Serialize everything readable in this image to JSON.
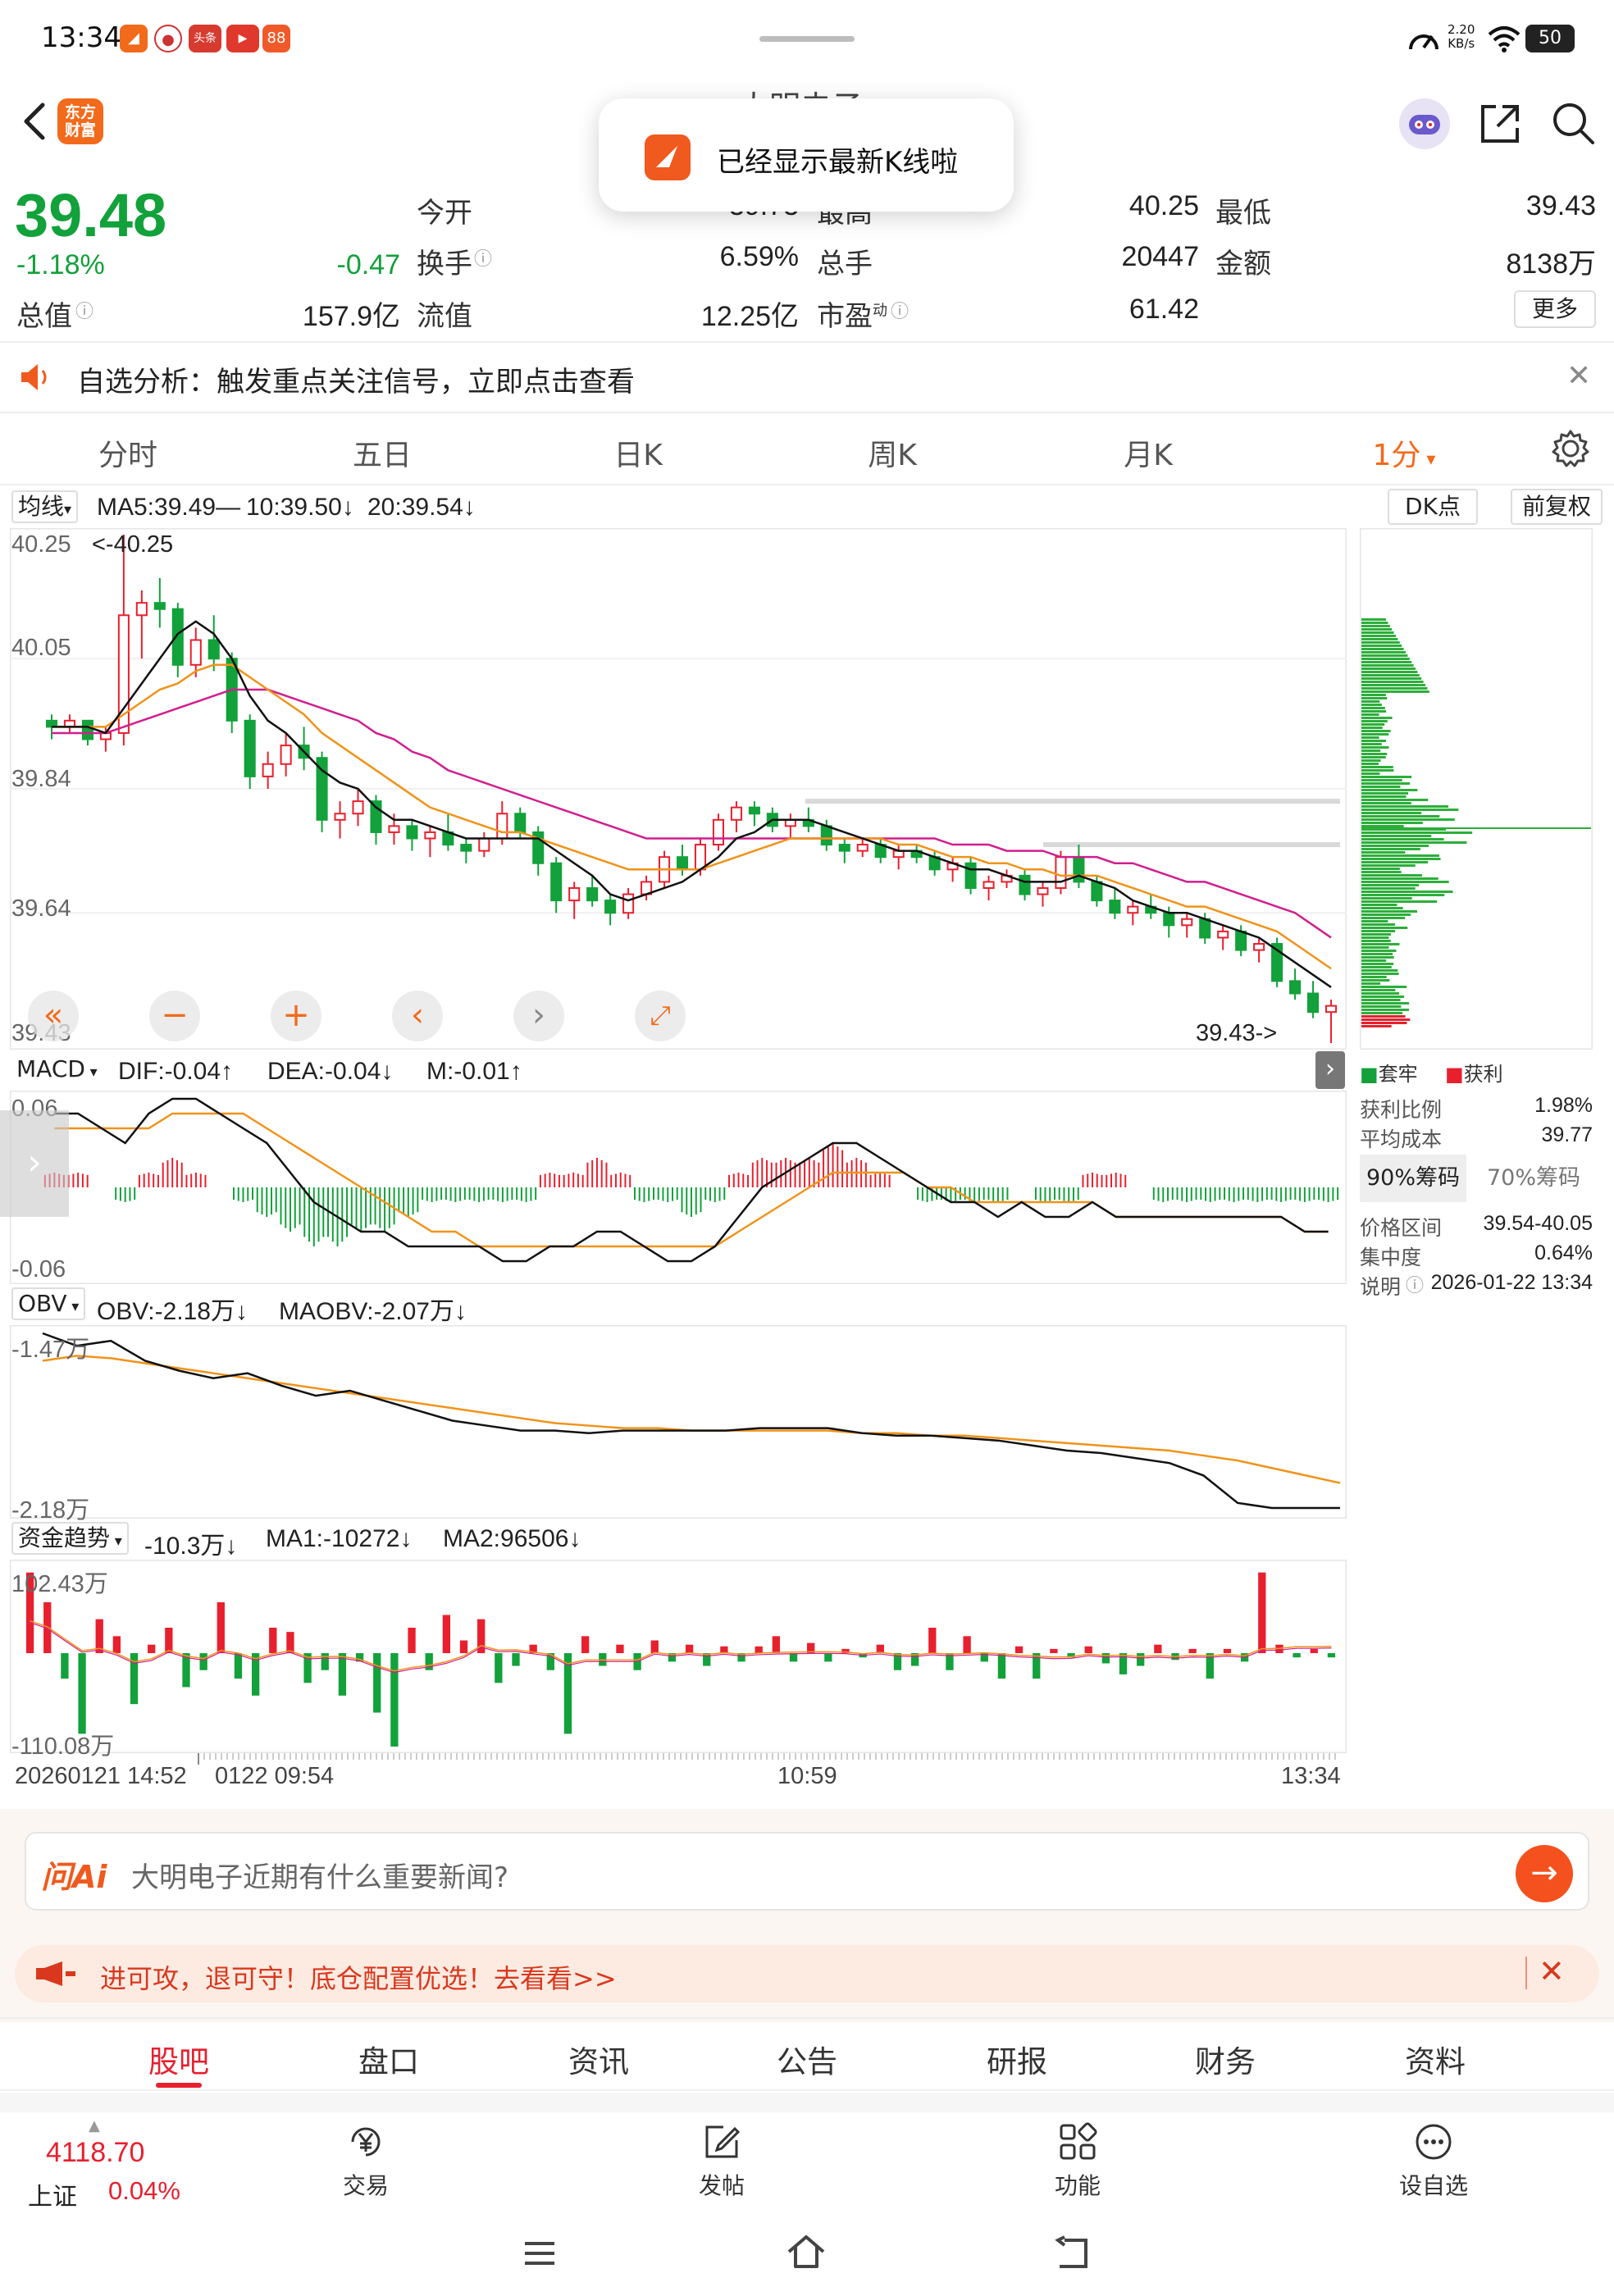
{
  "status_bar": {
    "time": "13:34",
    "net_speed_value": "2.20",
    "net_speed_unit": "KB/s",
    "battery": "50"
  },
  "toolbar": {
    "title": "大明电子",
    "logo_line1": "东方",
    "logo_line2": "财富"
  },
  "toast": {
    "text": "已经显示最新K线啦"
  },
  "quote": {
    "price": "39.48",
    "change_pct": "-1.18%",
    "change": "-0.47",
    "total_value_label": "总值",
    "total_value": "157.9亿",
    "open_label": "今开",
    "open": "39.73",
    "high_label": "最高",
    "high": "40.25",
    "low_label": "最低",
    "low": "39.43",
    "turnover_label": "换手",
    "turnover": "6.59%",
    "volume_label": "总手",
    "volume": "20447",
    "amount_label": "金额",
    "amount": "8138万",
    "float_label": "流值",
    "float_value": "12.25亿",
    "pe_label": "市盈",
    "pe_sup": "动",
    "pe": "61.42",
    "more_label": "更多"
  },
  "alert": {
    "text": "自选分析：触发重点关注信号，立即点击查看"
  },
  "period_tabs": [
    "分时",
    "五日",
    "日K",
    "周K",
    "月K",
    "1分"
  ],
  "kline": {
    "selector": "均线",
    "ma5": "MA5:39.49—",
    "ma10": "10:39.50",
    "ma20": "20:39.54",
    "dk_label": "DK点",
    "fuquan_label": "前复权",
    "y_ticks": [
      "40.25",
      "40.05",
      "39.84",
      "39.64",
      "39.43"
    ],
    "high_marker": "<-40.25",
    "low_marker": "39.43->"
  },
  "macd": {
    "selector": "MACD",
    "dif": "DIF:-0.04",
    "dea": "DEA:-0.04",
    "m": "M:-0.01",
    "y_top": "0.06",
    "y_bottom": "-0.06"
  },
  "obv": {
    "selector": "OBV",
    "obv": "OBV:-2.18万",
    "maobv": "MAOBV:-2.07万",
    "y_top": "-1.47万",
    "y_bottom": "-2.18万"
  },
  "fund": {
    "selector": "资金趋势",
    "value": "-10.3万",
    "ma1": "MA1:-10272",
    "ma2": "MA2:96506",
    "y_top": "102.43万",
    "y_bottom": "-110.08万"
  },
  "time_axis": [
    "20260121 14:52",
    "0122 09:54",
    "10:59",
    "13:34"
  ],
  "chips": {
    "legend_trapped": "套牢",
    "legend_profit": "获利",
    "profit_ratio_label": "获利比例",
    "profit_ratio": "1.98%",
    "avg_cost_label": "平均成本",
    "avg_cost": "39.77",
    "tab_90": "90%筹码",
    "tab_70": "70%筹码",
    "price_range_label": "价格区间",
    "price_range": "39.54-40.05",
    "concentration_label": "集中度",
    "concentration": "0.64%",
    "note_label": "说明",
    "note_date": "2026-01-22 13:34"
  },
  "ai": {
    "logo": "问Ai",
    "prompt": "大明电子近期有什么重要新闻?"
  },
  "promo": {
    "text": "进可攻，退可守！底仓配置优选！去看看>>"
  },
  "content_tabs": [
    "股吧",
    "盘口",
    "资讯",
    "公告",
    "研报",
    "财务",
    "资料"
  ],
  "bottom_nav": {
    "index_value": "4118.70",
    "index_name": "上证",
    "index_change": "0.04%",
    "items": [
      "交易",
      "发帖",
      "功能",
      "设自选"
    ]
  },
  "colors": {
    "up": "#e8202e",
    "down": "#12a13a",
    "ma5": "#111111",
    "ma10": "#f09319",
    "ma20": "#d01f8e",
    "accent": "#f26a1b"
  },
  "chart_data": [
    {
      "type": "candlestick",
      "title": "1分 K线",
      "ylim": [
        39.43,
        40.25
      ],
      "series_names": [
        "MA5",
        "MA10",
        "MA20"
      ],
      "candles": [
        [
          39.95,
          39.96,
          39.92,
          39.94
        ],
        [
          39.94,
          39.96,
          39.93,
          39.95
        ],
        [
          39.95,
          39.95,
          39.91,
          39.92
        ],
        [
          39.92,
          39.94,
          39.9,
          39.93
        ],
        [
          39.93,
          40.25,
          39.91,
          40.12
        ],
        [
          40.12,
          40.16,
          40.05,
          40.14
        ],
        [
          40.14,
          40.18,
          40.1,
          40.13
        ],
        [
          40.13,
          40.14,
          40.02,
          40.04
        ],
        [
          40.04,
          40.1,
          40.02,
          40.08
        ],
        [
          40.08,
          40.12,
          40.03,
          40.05
        ],
        [
          40.05,
          40.06,
          39.93,
          39.95
        ],
        [
          39.95,
          39.96,
          39.84,
          39.86
        ],
        [
          39.86,
          39.9,
          39.84,
          39.88
        ],
        [
          39.88,
          39.93,
          39.86,
          39.91
        ],
        [
          39.91,
          39.94,
          39.87,
          39.89
        ],
        [
          39.89,
          39.9,
          39.77,
          39.79
        ],
        [
          39.79,
          39.82,
          39.76,
          39.8
        ],
        [
          39.8,
          39.84,
          39.78,
          39.82
        ],
        [
          39.82,
          39.83,
          39.75,
          39.77
        ],
        [
          39.77,
          39.8,
          39.75,
          39.78
        ],
        [
          39.78,
          39.79,
          39.74,
          39.76
        ],
        [
          39.76,
          39.78,
          39.73,
          39.77
        ],
        [
          39.77,
          39.8,
          39.74,
          39.75
        ],
        [
          39.75,
          39.76,
          39.72,
          39.74
        ],
        [
          39.74,
          39.77,
          39.73,
          39.76
        ],
        [
          39.76,
          39.82,
          39.75,
          39.8
        ],
        [
          39.8,
          39.81,
          39.76,
          39.77
        ],
        [
          39.77,
          39.78,
          39.7,
          39.72
        ],
        [
          39.72,
          39.73,
          39.64,
          39.66
        ],
        [
          39.66,
          39.69,
          39.63,
          39.68
        ],
        [
          39.68,
          39.7,
          39.65,
          39.66
        ],
        [
          39.66,
          39.67,
          39.62,
          39.64
        ],
        [
          39.64,
          39.68,
          39.63,
          39.67
        ],
        [
          39.67,
          39.7,
          39.66,
          39.69
        ],
        [
          39.69,
          39.74,
          39.68,
          39.73
        ],
        [
          39.73,
          39.75,
          39.7,
          39.71
        ],
        [
          39.71,
          39.76,
          39.7,
          39.75
        ],
        [
          39.75,
          39.8,
          39.74,
          39.79
        ],
        [
          39.79,
          39.82,
          39.77,
          39.81
        ],
        [
          39.81,
          39.82,
          39.78,
          39.8
        ],
        [
          39.8,
          39.81,
          39.77,
          39.78
        ],
        [
          39.78,
          39.8,
          39.76,
          39.79
        ],
        [
          39.79,
          39.81,
          39.77,
          39.78
        ],
        [
          39.78,
          39.79,
          39.74,
          39.75
        ],
        [
          39.75,
          39.76,
          39.72,
          39.74
        ],
        [
          39.74,
          39.76,
          39.73,
          39.75
        ],
        [
          39.75,
          39.76,
          39.72,
          39.73
        ],
        [
          39.73,
          39.75,
          39.71,
          39.74
        ],
        [
          39.74,
          39.75,
          39.72,
          39.73
        ],
        [
          39.73,
          39.74,
          39.7,
          39.71
        ],
        [
          39.71,
          39.73,
          39.69,
          39.72
        ],
        [
          39.72,
          39.73,
          39.67,
          39.68
        ],
        [
          39.68,
          39.7,
          39.66,
          39.69
        ],
        [
          39.69,
          39.71,
          39.68,
          39.7
        ],
        [
          39.7,
          39.71,
          39.66,
          39.67
        ],
        [
          39.67,
          39.69,
          39.65,
          39.68
        ],
        [
          39.68,
          39.74,
          39.67,
          39.73
        ],
        [
          39.73,
          39.75,
          39.68,
          39.69
        ],
        [
          39.69,
          39.7,
          39.65,
          39.66
        ],
        [
          39.66,
          39.68,
          39.63,
          39.64
        ],
        [
          39.64,
          39.66,
          39.62,
          39.65
        ],
        [
          39.65,
          39.67,
          39.63,
          39.64
        ],
        [
          39.64,
          39.65,
          39.6,
          39.62
        ],
        [
          39.62,
          39.64,
          39.6,
          39.63
        ],
        [
          39.63,
          39.64,
          39.59,
          39.6
        ],
        [
          39.6,
          39.62,
          39.58,
          39.61
        ],
        [
          39.61,
          39.62,
          39.57,
          39.58
        ],
        [
          39.58,
          39.6,
          39.56,
          39.59
        ],
        [
          39.59,
          39.6,
          39.52,
          39.53
        ],
        [
          39.53,
          39.55,
          39.5,
          39.51
        ],
        [
          39.51,
          39.53,
          39.47,
          39.48
        ],
        [
          39.48,
          39.5,
          39.43,
          39.49
        ]
      ],
      "ma5": [
        39.94,
        39.94,
        39.94,
        39.93,
        39.97,
        40.01,
        40.05,
        40.09,
        40.11,
        40.09,
        40.05,
        39.99,
        39.95,
        39.93,
        39.9,
        39.87,
        39.85,
        39.84,
        39.81,
        39.79,
        39.79,
        39.78,
        39.77,
        39.76,
        39.76,
        39.76,
        39.76,
        39.76,
        39.74,
        39.72,
        39.7,
        39.67,
        39.66,
        39.67,
        39.68,
        39.69,
        39.71,
        39.73,
        39.76,
        39.77,
        39.79,
        39.79,
        39.79,
        39.78,
        39.77,
        39.76,
        39.75,
        39.74,
        39.74,
        39.73,
        39.72,
        39.71,
        39.71,
        39.7,
        39.69,
        39.69,
        39.69,
        39.7,
        39.69,
        39.68,
        39.66,
        39.65,
        39.64,
        39.64,
        39.63,
        39.62,
        39.61,
        39.6,
        39.58,
        39.56,
        39.54,
        39.52
      ],
      "ma10": [
        39.94,
        39.94,
        39.94,
        39.94,
        39.96,
        39.98,
        40.0,
        40.01,
        40.03,
        40.04,
        40.04,
        40.02,
        40.0,
        39.98,
        39.96,
        39.93,
        39.91,
        39.89,
        39.87,
        39.85,
        39.83,
        39.81,
        39.8,
        39.79,
        39.78,
        39.77,
        39.77,
        39.76,
        39.75,
        39.74,
        39.73,
        39.72,
        39.71,
        39.71,
        39.71,
        39.71,
        39.71,
        39.72,
        39.73,
        39.74,
        39.75,
        39.76,
        39.76,
        39.76,
        39.76,
        39.76,
        39.76,
        39.75,
        39.75,
        39.74,
        39.73,
        39.73,
        39.72,
        39.72,
        39.71,
        39.71,
        39.7,
        39.7,
        39.7,
        39.69,
        39.68,
        39.67,
        39.66,
        39.65,
        39.65,
        39.64,
        39.63,
        39.62,
        39.61,
        39.59,
        39.57,
        39.55
      ],
      "ma20": [
        39.93,
        39.93,
        39.93,
        39.93,
        39.94,
        39.95,
        39.96,
        39.97,
        39.98,
        39.99,
        40.0,
        40.0,
        40.0,
        39.99,
        39.98,
        39.97,
        39.96,
        39.95,
        39.93,
        39.92,
        39.9,
        39.89,
        39.87,
        39.86,
        39.85,
        39.84,
        39.83,
        39.82,
        39.81,
        39.8,
        39.79,
        39.78,
        39.77,
        39.76,
        39.76,
        39.76,
        39.76,
        39.76,
        39.76,
        39.76,
        39.76,
        39.76,
        39.76,
        39.76,
        39.76,
        39.76,
        39.76,
        39.76,
        39.76,
        39.76,
        39.75,
        39.75,
        39.75,
        39.74,
        39.74,
        39.74,
        39.73,
        39.73,
        39.73,
        39.72,
        39.72,
        39.71,
        39.7,
        39.69,
        39.69,
        39.68,
        39.67,
        39.66,
        39.65,
        39.64,
        39.62,
        39.6
      ]
    },
    {
      "type": "bar",
      "title": "MACD",
      "ylim": [
        -0.06,
        0.06
      ],
      "dif": [
        0.05,
        0.05,
        0.04,
        0.03,
        0.05,
        0.06,
        0.06,
        0.05,
        0.04,
        0.03,
        0.01,
        -0.01,
        -0.02,
        -0.03,
        -0.03,
        -0.04,
        -0.04,
        -0.04,
        -0.04,
        -0.05,
        -0.05,
        -0.04,
        -0.04,
        -0.03,
        -0.03,
        -0.04,
        -0.05,
        -0.05,
        -0.04,
        -0.02,
        0.0,
        0.01,
        0.02,
        0.03,
        0.03,
        0.02,
        0.01,
        0.0,
        -0.01,
        -0.01,
        -0.02,
        -0.01,
        -0.02,
        -0.02,
        -0.01,
        -0.02,
        -0.02,
        -0.02,
        -0.02,
        -0.02,
        -0.02,
        -0.02,
        -0.02,
        -0.03,
        -0.03
      ],
      "dea": [
        0.04,
        0.04,
        0.04,
        0.04,
        0.04,
        0.05,
        0.05,
        0.05,
        0.05,
        0.04,
        0.03,
        0.02,
        0.01,
        0.0,
        -0.01,
        -0.02,
        -0.03,
        -0.03,
        -0.04,
        -0.04,
        -0.04,
        -0.04,
        -0.04,
        -0.04,
        -0.04,
        -0.04,
        -0.04,
        -0.04,
        -0.04,
        -0.03,
        -0.02,
        -0.01,
        0.0,
        0.01,
        0.01,
        0.01,
        0.01,
        0.0,
        0.0,
        -0.01,
        -0.01,
        -0.01,
        -0.01,
        -0.01,
        -0.01,
        -0.02,
        -0.02,
        -0.02,
        -0.02,
        -0.02,
        -0.02,
        -0.02,
        -0.02,
        -0.03,
        -0.03
      ],
      "histogram": [
        0.01,
        0.01,
        0.0,
        -0.01,
        0.01,
        0.02,
        0.01,
        0.0,
        -0.01,
        -0.02,
        -0.03,
        -0.04,
        -0.04,
        -0.03,
        -0.03,
        -0.02,
        -0.01,
        -0.01,
        -0.01,
        -0.01,
        -0.01,
        0.01,
        0.01,
        0.02,
        0.01,
        -0.01,
        -0.01,
        -0.02,
        -0.01,
        0.01,
        0.02,
        0.02,
        0.02,
        0.03,
        0.02,
        0.01,
        0.0,
        -0.01,
        -0.01,
        -0.01,
        -0.01,
        0.0,
        -0.01,
        -0.01,
        0.01,
        0.01,
        0.0,
        -0.01,
        -0.01,
        -0.01,
        -0.01,
        -0.01,
        -0.01,
        -0.01,
        -0.01
      ]
    },
    {
      "type": "line",
      "title": "OBV",
      "ylim": [
        -2.18,
        -1.47
      ],
      "series": [
        {
          "name": "OBV",
          "values": [
            -1.47,
            -1.52,
            -1.5,
            -1.58,
            -1.62,
            -1.65,
            -1.63,
            -1.68,
            -1.72,
            -1.7,
            -1.74,
            -1.78,
            -1.82,
            -1.84,
            -1.86,
            -1.86,
            -1.87,
            -1.86,
            -1.86,
            -1.86,
            -1.86,
            -1.85,
            -1.85,
            -1.85,
            -1.87,
            -1.88,
            -1.88,
            -1.89,
            -1.9,
            -1.92,
            -1.94,
            -1.95,
            -1.97,
            -1.99,
            -2.04,
            -2.15,
            -2.17,
            -2.17,
            -2.17
          ]
        },
        {
          "name": "MAOBV",
          "values": [
            -1.58,
            -1.56,
            -1.57,
            -1.59,
            -1.61,
            -1.63,
            -1.65,
            -1.67,
            -1.69,
            -1.71,
            -1.73,
            -1.75,
            -1.77,
            -1.79,
            -1.81,
            -1.83,
            -1.84,
            -1.85,
            -1.85,
            -1.86,
            -1.86,
            -1.86,
            -1.86,
            -1.86,
            -1.87,
            -1.87,
            -1.88,
            -1.88,
            -1.89,
            -1.9,
            -1.91,
            -1.92,
            -1.93,
            -1.94,
            -1.96,
            -1.98,
            -2.01,
            -2.04,
            -2.07
          ]
        }
      ]
    },
    {
      "type": "bar",
      "title": "资金趋势",
      "ylim": [
        -110.08,
        102.43
      ],
      "values": [
        95,
        60,
        -30,
        -95,
        40,
        20,
        -60,
        10,
        30,
        -40,
        -20,
        60,
        -30,
        -50,
        30,
        25,
        -35,
        -20,
        -50,
        -10,
        -70,
        -110,
        30,
        -20,
        45,
        15,
        40,
        -35,
        -15,
        10,
        -20,
        -95,
        20,
        -15,
        10,
        -20,
        15,
        -10,
        10,
        -15,
        8,
        -10,
        8,
        20,
        -10,
        12,
        -10,
        5,
        -5,
        10,
        -20,
        -15,
        30,
        -20,
        20,
        -10,
        -30,
        8,
        -30,
        5,
        -5,
        8,
        -12,
        -25,
        -15,
        10,
        -8,
        5,
        -30,
        5,
        -10,
        95,
        10,
        -5,
        5,
        -5
      ]
    }
  ]
}
